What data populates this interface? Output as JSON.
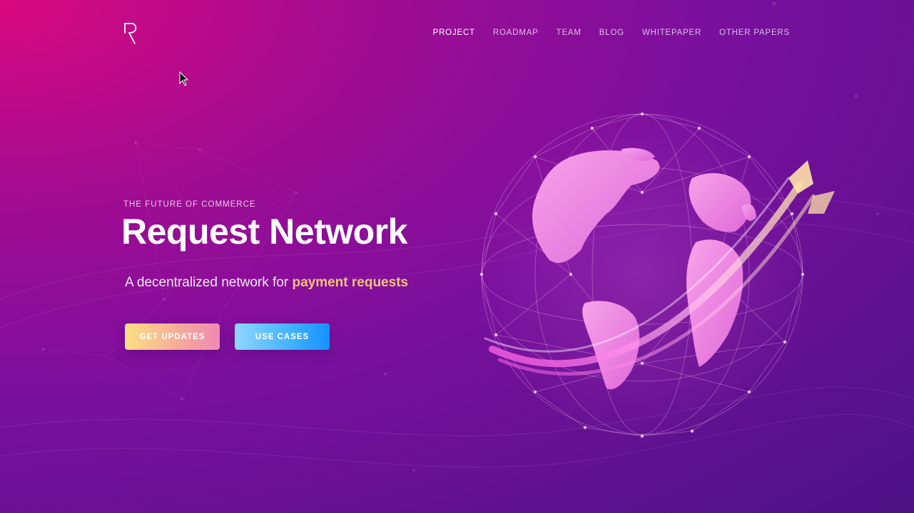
{
  "nav": {
    "items": [
      {
        "label": "PROJECT",
        "active": true
      },
      {
        "label": "ROADMAP",
        "active": false
      },
      {
        "label": "TEAM",
        "active": false
      },
      {
        "label": "BLOG",
        "active": false
      },
      {
        "label": "WHITEPAPER",
        "active": false
      },
      {
        "label": "OTHER PAPERS",
        "active": false
      }
    ]
  },
  "hero": {
    "eyebrow": "THE FUTURE OF COMMERCE",
    "title": "Request Network",
    "subtitle_prefix": "A decentralized network for ",
    "subtitle_highlight": "payment requests",
    "buttons": {
      "updates": "GET UPDATES",
      "use_cases": "USE CASES"
    }
  },
  "colors": {
    "highlight": "#f2c37a",
    "bg_top_left": "#d9087f",
    "bg_bottom_right": "#4c1284"
  },
  "icons": {
    "logo": "request-r-logo",
    "globe": "network-globe-illustration",
    "cursor": "mouse-pointer"
  }
}
